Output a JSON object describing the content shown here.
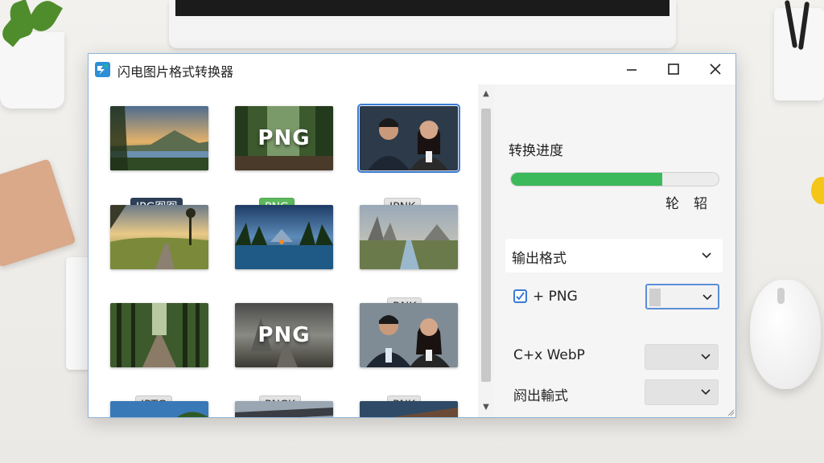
{
  "window": {
    "title": "闪电图片格式转换器"
  },
  "gallery": {
    "items": [
      {
        "scene": "lake-landscape",
        "tag": "JPG图图",
        "tag_style": "dark"
      },
      {
        "scene": "forest-png",
        "overlay": "PNG",
        "tag": "PNG",
        "tag_style": "green"
      },
      {
        "scene": "portrait-pair",
        "tag": "JPNK",
        "tag_style": "light",
        "selected": true
      },
      {
        "scene": "country-road"
      },
      {
        "scene": "mountain-lake"
      },
      {
        "scene": "rock-canal",
        "tag": "RNK",
        "tag_style": "light"
      },
      {
        "scene": "forest-path",
        "tag": "JPTG",
        "tag_style": "light"
      },
      {
        "scene": "rock-png",
        "overlay": "PNG",
        "tag": "PNCK",
        "tag_style": "light"
      },
      {
        "scene": "portrait-pair-2",
        "tag": "PNK",
        "tag_style": "light"
      },
      {
        "scene": "partial-sky"
      },
      {
        "scene": "partial-bridge"
      },
      {
        "scene": "partial-building"
      }
    ]
  },
  "panel": {
    "progress_label": "转换进度",
    "progress": 0.73,
    "status_text": "轮轺",
    "output_format_label": "输出格式",
    "options": [
      {
        "label": "+ PNG",
        "checked": true,
        "select_active": true
      },
      {
        "label": "C+x WebP",
        "checked": false,
        "select_active": false
      },
      {
        "label": "阏出輸式",
        "checked": false,
        "select_active": false
      }
    ]
  },
  "colors": {
    "accent": "#3a7bd5",
    "progress_fill": "#3cb95a",
    "window_border": "#8fb3d6"
  },
  "icons": {
    "app": "lightning-app-icon",
    "minimize": "minimize-icon",
    "maximize": "maximize-icon",
    "close": "close-icon",
    "dropdown": "chevron-down-icon"
  }
}
